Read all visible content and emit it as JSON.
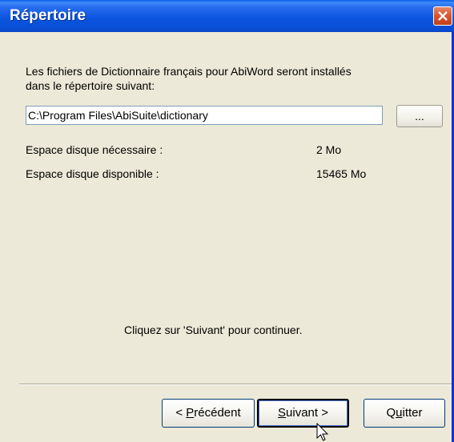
{
  "window": {
    "title": "Répertoire",
    "close_icon": "close-icon"
  },
  "main": {
    "intro_line1": "Les fichiers de Dictionnaire français pour AbiWord seront installés",
    "intro_line2": "dans le répertoire suivant:",
    "path_value": "C:\\Program Files\\AbiSuite\\dictionary",
    "browse_label": "...",
    "space_required_label": "Espace disque nécessaire :",
    "space_required_value": "2 Mo",
    "space_available_label": "Espace disque disponible :",
    "space_available_value": "15465 Mo",
    "continue_hint": "Cliquez sur 'Suivant' pour continuer."
  },
  "footer": {
    "back_label_prefix": "< ",
    "back_label_accel": "P",
    "back_label_rest": "récédent",
    "next_label_accel": "S",
    "next_label_rest": "uivant >",
    "quit_label_prefix": "Q",
    "quit_label_accel": "u",
    "quit_label_rest": "itter"
  }
}
